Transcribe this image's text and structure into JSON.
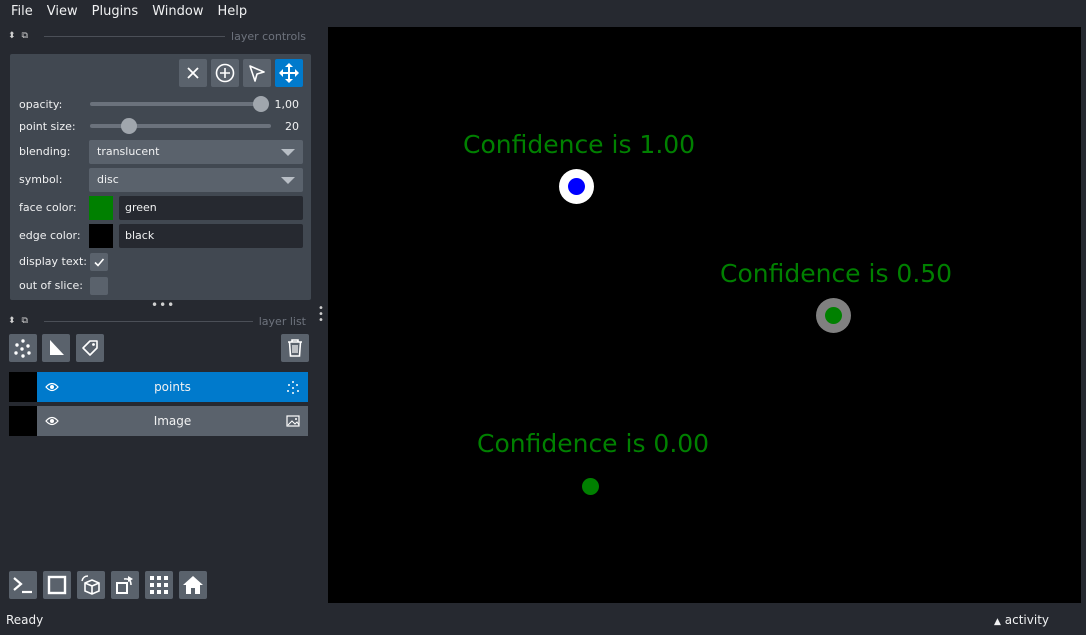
{
  "menu": {
    "file": "File",
    "view": "View",
    "plugins": "Plugins",
    "window": "Window",
    "help": "Help"
  },
  "layer_controls": {
    "title": "layer controls",
    "opacity_label": "opacity:",
    "opacity_value": "1,00",
    "opacity_fraction": 1.0,
    "point_size_label": "point size:",
    "point_size_value": "20",
    "blending_label": "blending:",
    "blending_value": "translucent",
    "symbol_label": "symbol:",
    "symbol_value": "disc",
    "face_color_label": "face color:",
    "face_color_value": "green",
    "face_color_hex": "#008000",
    "edge_color_label": "edge color:",
    "edge_color_value": "black",
    "edge_color_hex": "#000000",
    "display_text_label": "display text:",
    "display_text_checked": true,
    "out_of_slice_label": "out of slice:",
    "out_of_slice_checked": false,
    "mode_buttons": [
      "close-icon",
      "add-point-icon",
      "select-icon",
      "pan-zoom-icon"
    ],
    "active_mode": "pan-zoom-icon"
  },
  "layer_list": {
    "title": "layer list",
    "layers": [
      {
        "name": "points",
        "type_icon": "points-icon",
        "selected": true,
        "visible": true
      },
      {
        "name": "Image",
        "type_icon": "image-icon",
        "selected": false,
        "visible": true
      }
    ]
  },
  "canvas": {
    "points": [
      {
        "label": "Confidence is 1.00",
        "face_color": "#0000ff",
        "edge_color": "#ffffff"
      },
      {
        "label": "Confidence is 0.50",
        "face_color": "#008000",
        "edge_color": "#808080"
      },
      {
        "label": "Confidence is 0.00",
        "face_color": "#008000",
        "edge_color": "#000000"
      }
    ],
    "text_color": "#008000"
  },
  "status": {
    "text": "Ready",
    "activity": "activity"
  },
  "colors": {
    "accent": "#007acc",
    "background": "#262930",
    "panel": "#414851",
    "button": "#5a626c"
  }
}
